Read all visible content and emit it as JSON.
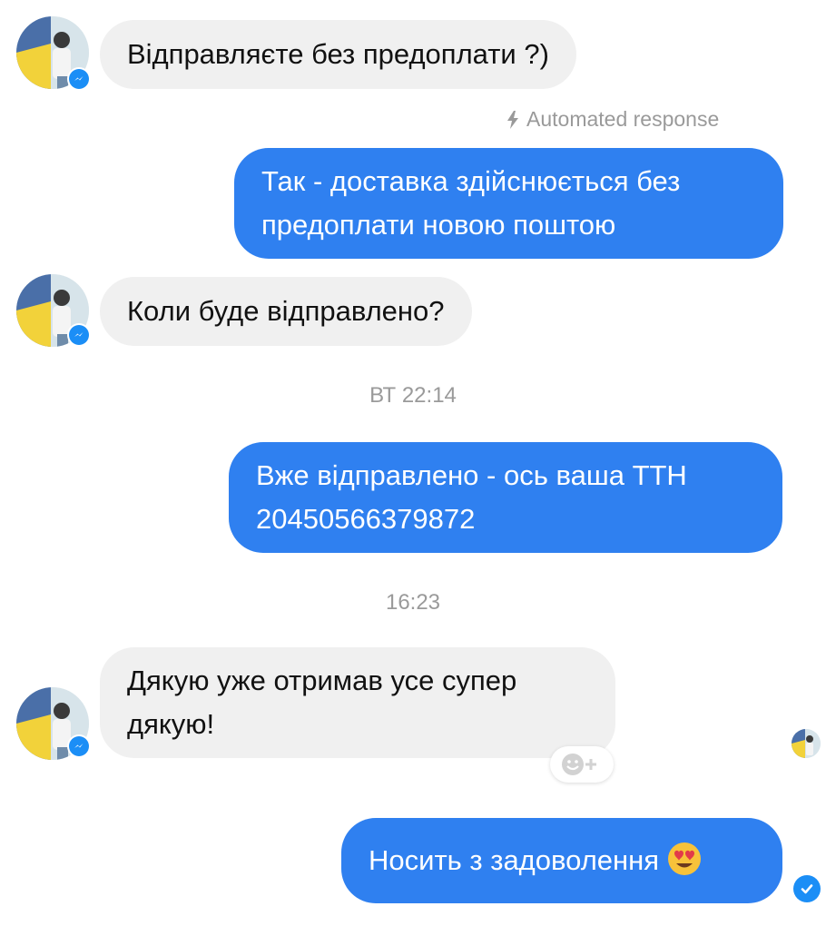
{
  "messages": {
    "m1": {
      "text": "Відправляєте без предоплати ?)"
    },
    "automated": {
      "label": "Automated response"
    },
    "m2": {
      "line1": "Так - доставка здійснюється без",
      "line2": "предоплати новою поштою"
    },
    "m3": {
      "text": "Коли буде відправлено?"
    },
    "ts1": "ВТ 22:14",
    "m4": {
      "line1": "Вже відправлено - ось ваша ТТН",
      "line2": "20450566379872"
    },
    "ts2": "16:23",
    "m5": {
      "line1": "Дякую уже отримав усе супер",
      "line2": "дякую!"
    },
    "m6": {
      "text": "Носить з задоволення"
    }
  },
  "icons": [
    "avatar",
    "messenger-badge-icon",
    "lightning-icon",
    "add-reaction-icon",
    "heart-eyes-emoji",
    "delivered-check-icon"
  ],
  "colors": {
    "outgoing_bubble": "#2f80f0",
    "incoming_bubble": "#f0f0f0",
    "meta_text": "#9a9a9a",
    "messenger_blue": "#1b8ef6"
  }
}
